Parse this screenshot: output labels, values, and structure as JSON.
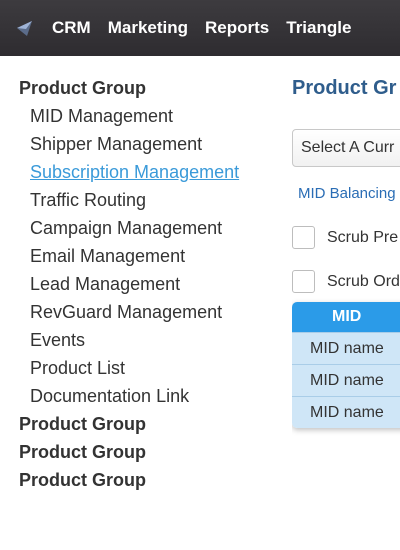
{
  "topbar": {
    "logo_icon": "triangle-logo-icon",
    "nav": [
      "CRM",
      "Marketing",
      "Reports",
      "Triangle"
    ]
  },
  "sidebar": {
    "groups": [
      {
        "title": "Product Group",
        "items": [
          "MID Management",
          "Shipper Management",
          "Subscription Management",
          "Traffic Routing",
          "Campaign Management",
          "Email Management",
          "Lead Management",
          "RevGuard Management",
          "Events",
          "Product List",
          "Documentation Link"
        ],
        "active_item": "Subscription Management"
      },
      {
        "title": "Product Group"
      },
      {
        "title": "Product Group"
      },
      {
        "title": "Product Group"
      }
    ]
  },
  "main": {
    "title": "Product Gr",
    "select_value": "Select A Curr",
    "link": "MID Balancing",
    "checkboxes": [
      {
        "label": "Scrub Pre",
        "checked": false
      },
      {
        "label": "Scrub Ord",
        "checked": false
      }
    ],
    "mid_table": {
      "header": "MID",
      "rows": [
        "MID name",
        "MID name",
        "MID name"
      ]
    }
  },
  "colors": {
    "topbar": "#2e2c30",
    "active_link": "#3a9ad9",
    "title": "#2f5d8c",
    "table_header": "#2b9be8",
    "table_row": "#cfe6f7"
  }
}
